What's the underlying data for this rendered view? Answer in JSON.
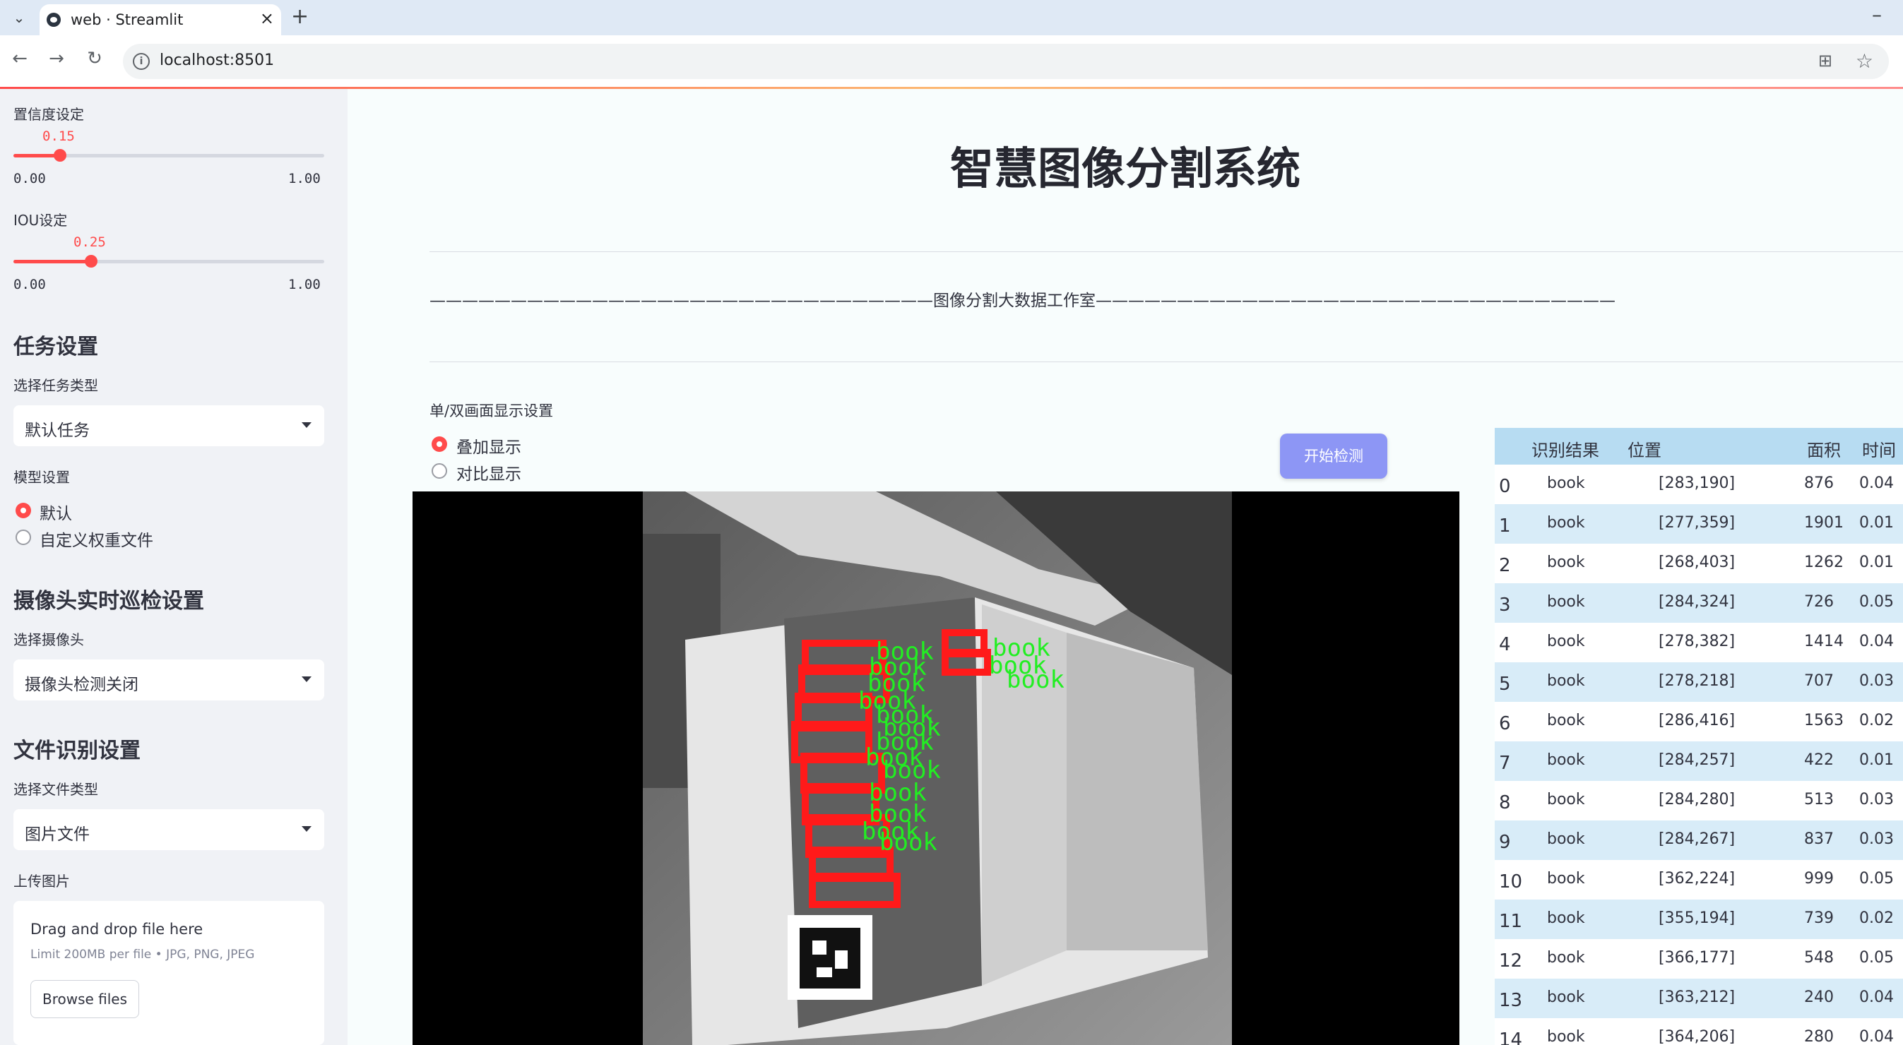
{
  "browser": {
    "tab_title": "web · Streamlit",
    "url": "localhost:8501"
  },
  "sidebar": {
    "confidence": {
      "label": "置信度设定",
      "value": "0.15",
      "min": "0.00",
      "max": "1.00",
      "fraction": 0.15
    },
    "iou": {
      "label": "IOU设定",
      "value": "0.25",
      "min": "0.00",
      "max": "1.00",
      "fraction": 0.25
    },
    "task_heading": "任务设置",
    "task_type_label": "选择任务类型",
    "task_type_value": "默认任务",
    "model_label": "模型设置",
    "model_options": [
      "默认",
      "自定义权重文件"
    ],
    "model_selected": 0,
    "camera_heading": "摄像头实时巡检设置",
    "camera_label": "选择摄像头",
    "camera_value": "摄像头检测关闭",
    "file_heading": "文件识别设置",
    "file_type_label": "选择文件类型",
    "file_type_value": "图片文件",
    "upload_label": "上传图片",
    "upload": {
      "title": "Drag and drop file here",
      "limit": "Limit 200MB per file • JPG, PNG, JPEG",
      "button": "Browse files"
    }
  },
  "main": {
    "title": "智慧图像分割系统",
    "banner": "———————————————————————————————图像分割大数据工作室————————————————————————————————",
    "display_mode_label": "单/双画面显示设置",
    "display_options": [
      "叠加显示",
      "对比显示"
    ],
    "display_selected": 0,
    "detect_button": "开始检测",
    "detection_label_text": "book"
  },
  "table": {
    "headers": [
      "识别结果",
      "位置",
      "面积",
      "时间"
    ],
    "rows": [
      {
        "idx": "0",
        "result": "book",
        "pos": "[283,190]",
        "area": "876",
        "time": "0.04"
      },
      {
        "idx": "1",
        "result": "book",
        "pos": "[277,359]",
        "area": "1901",
        "time": "0.01"
      },
      {
        "idx": "2",
        "result": "book",
        "pos": "[268,403]",
        "area": "1262",
        "time": "0.01"
      },
      {
        "idx": "3",
        "result": "book",
        "pos": "[284,324]",
        "area": "726",
        "time": "0.05"
      },
      {
        "idx": "4",
        "result": "book",
        "pos": "[278,382]",
        "area": "1414",
        "time": "0.04"
      },
      {
        "idx": "5",
        "result": "book",
        "pos": "[278,218]",
        "area": "707",
        "time": "0.03"
      },
      {
        "idx": "6",
        "result": "book",
        "pos": "[286,416]",
        "area": "1563",
        "time": "0.02"
      },
      {
        "idx": "7",
        "result": "book",
        "pos": "[284,257]",
        "area": "422",
        "time": "0.01"
      },
      {
        "idx": "8",
        "result": "book",
        "pos": "[284,280]",
        "area": "513",
        "time": "0.03"
      },
      {
        "idx": "9",
        "result": "book",
        "pos": "[284,267]",
        "area": "837",
        "time": "0.03"
      },
      {
        "idx": "10",
        "result": "book",
        "pos": "[362,224]",
        "area": "999",
        "time": "0.05"
      },
      {
        "idx": "11",
        "result": "book",
        "pos": "[355,194]",
        "area": "739",
        "time": "0.02"
      },
      {
        "idx": "12",
        "result": "book",
        "pos": "[366,177]",
        "area": "548",
        "time": "0.05"
      },
      {
        "idx": "13",
        "result": "book",
        "pos": "[363,212]",
        "area": "240",
        "time": "0.04"
      },
      {
        "idx": "14",
        "result": "book",
        "pos": "[364,206]",
        "area": "280",
        "time": "0.04"
      }
    ]
  },
  "colors": {
    "accent": "#ff4b4b",
    "detect_button": "#8d96f5",
    "table_header": "#b7dcf2",
    "table_stripe": "#d8ecf8",
    "mask_red": "#ff1a1a",
    "label_green": "#22ee22"
  }
}
